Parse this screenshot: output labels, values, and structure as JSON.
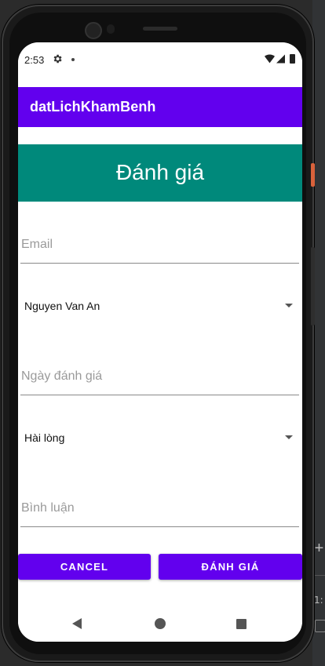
{
  "status_bar": {
    "time": "2:53",
    "icons": [
      "gear-icon",
      "notification-dot-icon",
      "wifi-icon",
      "signal-icon",
      "battery-icon"
    ]
  },
  "app_bar": {
    "title": "datLichKhamBenh",
    "color": "#6200ee"
  },
  "banner": {
    "title": "Đánh giá",
    "color": "#00897b"
  },
  "form": {
    "email": {
      "value": "",
      "placeholder": "Email"
    },
    "doctor_select": {
      "selected": "Nguyen Van An"
    },
    "date": {
      "value": "",
      "placeholder": "Ngày đánh giá"
    },
    "satisfaction_select": {
      "selected": "Hài lòng"
    },
    "comment": {
      "value": "",
      "placeholder": "Bình luận"
    }
  },
  "buttons": {
    "cancel_label": "CANCEL",
    "submit_label": "ĐÁNH GIÁ"
  },
  "nav_bar": {
    "icons": [
      "back-icon",
      "home-icon",
      "recents-icon"
    ]
  },
  "ide": {
    "zoom_label": "1:"
  }
}
